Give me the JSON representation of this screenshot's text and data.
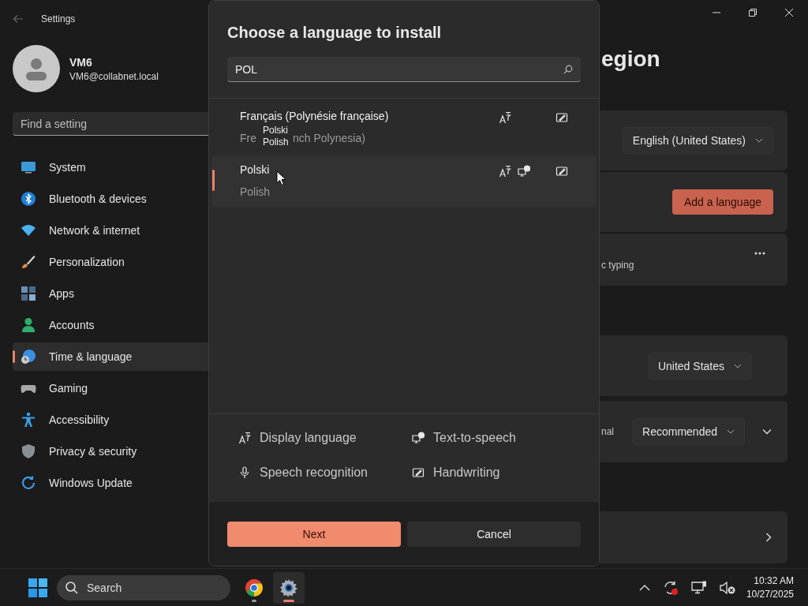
{
  "window": {
    "title": "Settings"
  },
  "user": {
    "name": "VM6",
    "email": "VM6@collabnet.local"
  },
  "search": {
    "placeholder": "Find a setting"
  },
  "nav": [
    {
      "label": "System",
      "selected": false
    },
    {
      "label": "Bluetooth & devices",
      "selected": false
    },
    {
      "label": "Network & internet",
      "selected": false
    },
    {
      "label": "Personalization",
      "selected": false
    },
    {
      "label": "Apps",
      "selected": false
    },
    {
      "label": "Accounts",
      "selected": false
    },
    {
      "label": "Time & language",
      "selected": true
    },
    {
      "label": "Gaming",
      "selected": false
    },
    {
      "label": "Accessibility",
      "selected": false
    },
    {
      "label": "Privacy & security",
      "selected": false
    },
    {
      "label": "Windows Update",
      "selected": false
    }
  ],
  "page": {
    "title_fragment": "egion",
    "cards": [
      {
        "controls": [
          {
            "kind": "dropdown",
            "label": "English (United States)"
          }
        ]
      },
      {
        "controls": [
          {
            "kind": "button",
            "label": "Add a language"
          }
        ]
      },
      {
        "fragment": "c typing",
        "controls": [
          {
            "kind": "more"
          }
        ]
      },
      {
        "controls": [
          {
            "kind": "dropdown",
            "label": "United States"
          }
        ]
      },
      {
        "fragment": "nal",
        "controls": [
          {
            "kind": "dropdown",
            "label": "Recommended"
          },
          {
            "kind": "expand"
          }
        ]
      },
      {
        "controls": [
          {
            "kind": "chevron"
          }
        ]
      }
    ]
  },
  "dialog": {
    "title": "Choose a language to install",
    "search": {
      "value": "POL"
    },
    "languages": [
      {
        "name": "Français (Polynésie française)",
        "subtitle_parts": [
          "Fre",
          "nch Polynesia)"
        ],
        "selected": false,
        "features": {
          "display": true,
          "tts": false,
          "speech": false,
          "handwriting": true
        }
      },
      {
        "name": "Polski",
        "subtitle_parts": [
          "Polish"
        ],
        "selected": true,
        "features": {
          "display": true,
          "tts": true,
          "speech": false,
          "handwriting": true
        }
      }
    ],
    "tooltip": {
      "lines": [
        "Polski",
        "Polish"
      ]
    },
    "legend": [
      {
        "kind": "display",
        "label": "Display language"
      },
      {
        "kind": "tts",
        "label": "Text-to-speech"
      },
      {
        "kind": "speech",
        "label": "Speech recognition"
      },
      {
        "kind": "handwriting",
        "label": "Handwriting"
      }
    ],
    "buttons": [
      {
        "kind": "primary",
        "label": "Next"
      },
      {
        "kind": "secondary",
        "label": "Cancel"
      }
    ]
  },
  "taskbar": {
    "search": {
      "placeholder": "Search"
    },
    "apps": [
      {
        "kind": "browser",
        "active": false
      },
      {
        "kind": "settings",
        "active": true
      }
    ],
    "time": "10:32 AM",
    "date": "10/27/2025"
  }
}
